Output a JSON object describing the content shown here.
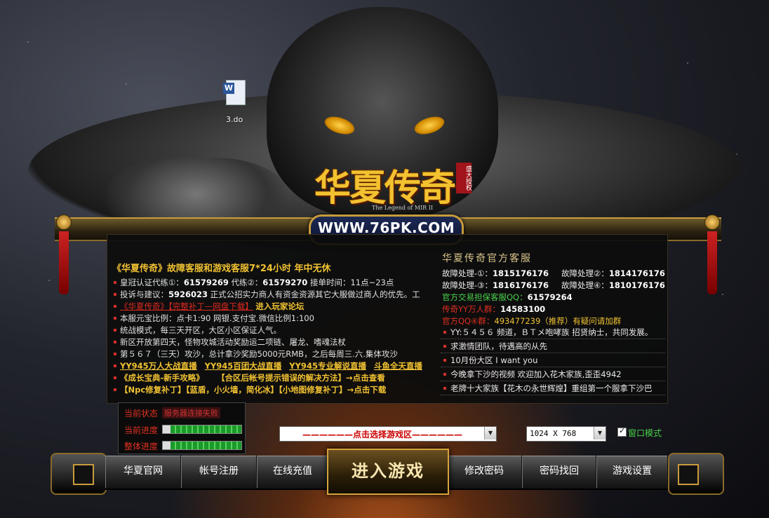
{
  "desktop": {
    "file_label": "3.do"
  },
  "logo": {
    "title": "华夏传奇",
    "seal": "盛大授权",
    "subtitle": "The Legend of MIR II",
    "url": "WWW.76PK.COM"
  },
  "news": {
    "headline": "《华夏传奇》故障客服和游戏客服7*24小时 年中无休",
    "rows": [
      {
        "pre": "皇冠认证代练①：",
        "n1": "61579269",
        "mid": " 代练②：",
        "n2": "61579270",
        "post": " 接单时间：11点~23点"
      },
      {
        "pre": "投诉与建议：",
        "n1": "5926023",
        "post": " 正式公招实力商人有资金资源其它大服做过商人的优先。工"
      },
      {
        "red": "《华夏传奇》【完整补丁—网盘下载】",
        "gold": "进入玩家论坛"
      },
      {
        "text": "本服元宝比例：点卡1:90 网银.支付宝.微信比例1:100"
      },
      {
        "text": "统战模式，每三天开区，大区小区保证人气。"
      },
      {
        "text": "新区开放第四天，怪物攻城活动奖励运二项链、屠龙、嗜魂法杖"
      },
      {
        "text": "第５６７（三天）攻沙，总计拿沙奖励5000元RMB，之后每周三.六.集体攻沙"
      }
    ],
    "links_row": [
      "YY945万人大战直播",
      "YY945百团大战直播",
      "YY945专业解说直播",
      "斗鱼全天直播"
    ],
    "guide_row": {
      "a": "《成长宝典-新手攻略》",
      "b": "【合区后帐号提示错误的解决方法】→点击查看"
    },
    "patch_row": {
      "a": "【Npc修复补丁】",
      "b": "【蓝盾，小火墙，简化冰】",
      "c": "【小地图修复补丁】→点击下载"
    }
  },
  "service": {
    "title": "华夏传奇官方客服",
    "faults": [
      {
        "label": "故障处理-①：",
        "num": "1815176176"
      },
      {
        "label": "故障处理②：",
        "num": "1814176176"
      },
      {
        "label": "故障处理-③：",
        "num": "1816176176"
      },
      {
        "label": "故障处理④：",
        "num": "1810176176"
      }
    ],
    "escrow": {
      "label": "官方交易担保客服QQ：",
      "num": "61579264"
    },
    "yy_group": {
      "label": "传奇YY万人群：",
      "num": "14583100"
    },
    "qq_group": {
      "label": "官方QQ④群：",
      "value": "493477239（推荐）有疑问请加群"
    },
    "announcements": [
      "YY:５４５６ 频道，ＢＴメ咆哮族 招贤纳士，共同发展。",
      "求激情团队，待遇高的从先",
      "10月份大区 I want you",
      "今晚拿下沙的视频 欢迎加入花木家族,歪歪4942",
      "老牌十大家族【花木の永世辉煌】重组第一个服拿下沙巴"
    ]
  },
  "status": {
    "state_label": "当前状态",
    "state_value": "服务器连接失败",
    "current_label": "当前进度",
    "current_progress": 0.9,
    "overall_label": "整体进度",
    "overall_progress": 0.9
  },
  "zone_select": {
    "value": "——————点击选择游戏区——————"
  },
  "resolution": {
    "value": "1024 X 768"
  },
  "window_mode": {
    "label": "窗口模式",
    "checked": true
  },
  "menu": {
    "official": "华夏官网",
    "register": "帐号注册",
    "recharge": "在线充值",
    "enter": "进入游戏",
    "change_pw": "修改密码",
    "recover_pw": "密码找回",
    "settings": "游戏设置"
  },
  "colors": {
    "gold": "#f1c232",
    "red": "#e02a20",
    "green": "#4ad04a"
  }
}
